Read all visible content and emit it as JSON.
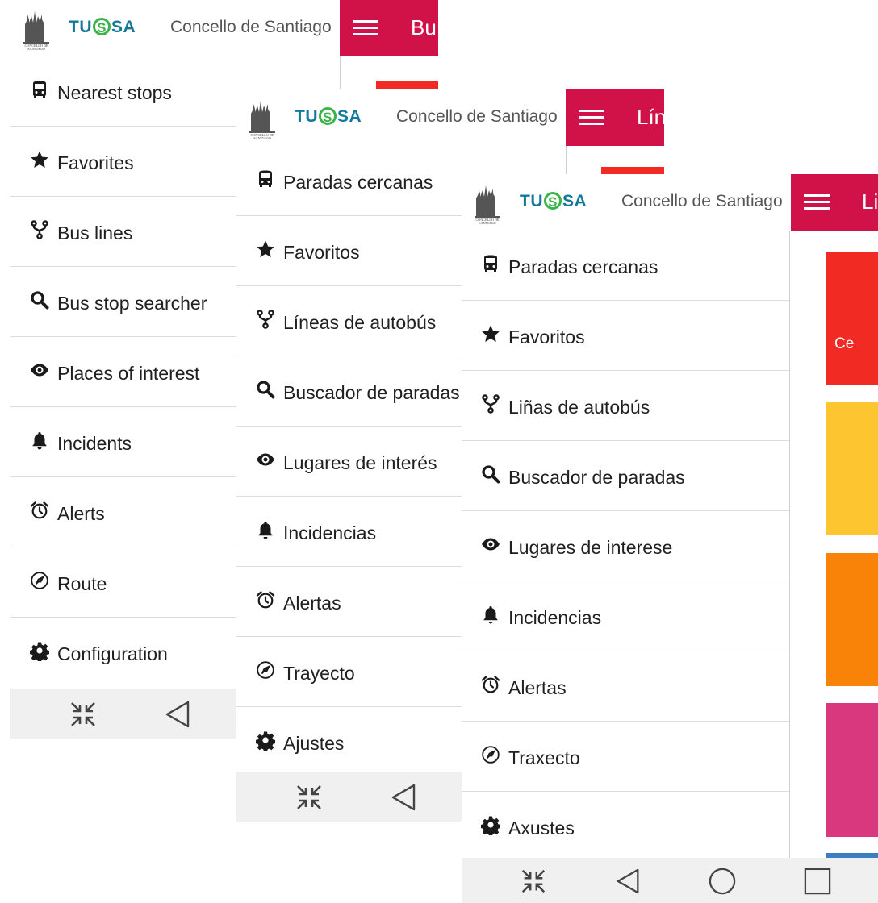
{
  "brand": {
    "logo_text": "TUSSA",
    "city": "Concello de Santiago",
    "crest_caption": "CONCELLO DE SANTIAGO"
  },
  "colors": {
    "accent": "#d11248",
    "red": "#f22a24",
    "yellow": "#fdc631",
    "orange": "#f98309",
    "pink": "#d9387f",
    "blue": "#3b7ec1"
  },
  "screens": [
    {
      "lang": "en",
      "title_partial": "Bu",
      "menu": [
        {
          "icon": "bus-icon",
          "label": "Nearest stops"
        },
        {
          "icon": "star-icon",
          "label": "Favorites"
        },
        {
          "icon": "fork-icon",
          "label": "Bus lines"
        },
        {
          "icon": "search-icon",
          "label": "Bus stop searcher"
        },
        {
          "icon": "eye-icon",
          "label": "Places of interest"
        },
        {
          "icon": "bell-icon",
          "label": "Incidents"
        },
        {
          "icon": "alarm-clock-icon",
          "label": "Alerts"
        },
        {
          "icon": "compass-icon",
          "label": "Route"
        },
        {
          "icon": "gear-icon",
          "label": "Configuration"
        }
      ]
    },
    {
      "lang": "es",
      "title_partial": "Lín",
      "menu": [
        {
          "icon": "bus-icon",
          "label": "Paradas cercanas"
        },
        {
          "icon": "star-icon",
          "label": "Favoritos"
        },
        {
          "icon": "fork-icon",
          "label": "Líneas de autobús"
        },
        {
          "icon": "search-icon",
          "label": "Buscador de paradas"
        },
        {
          "icon": "eye-icon",
          "label": "Lugares de interés"
        },
        {
          "icon": "bell-icon",
          "label": "Incidencias"
        },
        {
          "icon": "alarm-clock-icon",
          "label": "Alertas"
        },
        {
          "icon": "compass-icon",
          "label": "Trayecto"
        },
        {
          "icon": "gear-icon",
          "label": "Ajustes"
        }
      ]
    },
    {
      "lang": "gl",
      "title_partial": "Li",
      "tile_partial_text": "Ce",
      "menu": [
        {
          "icon": "bus-icon",
          "label": "Paradas cercanas"
        },
        {
          "icon": "star-icon",
          "label": "Favoritos"
        },
        {
          "icon": "fork-icon",
          "label": "Liñas de autobús"
        },
        {
          "icon": "search-icon",
          "label": "Buscador de paradas"
        },
        {
          "icon": "eye-icon",
          "label": "Lugares de interese"
        },
        {
          "icon": "bell-icon",
          "label": "Incidencias"
        },
        {
          "icon": "alarm-clock-icon",
          "label": "Alertas"
        },
        {
          "icon": "compass-icon",
          "label": "Traxecto"
        },
        {
          "icon": "gear-icon",
          "label": "Axustes"
        }
      ]
    }
  ]
}
